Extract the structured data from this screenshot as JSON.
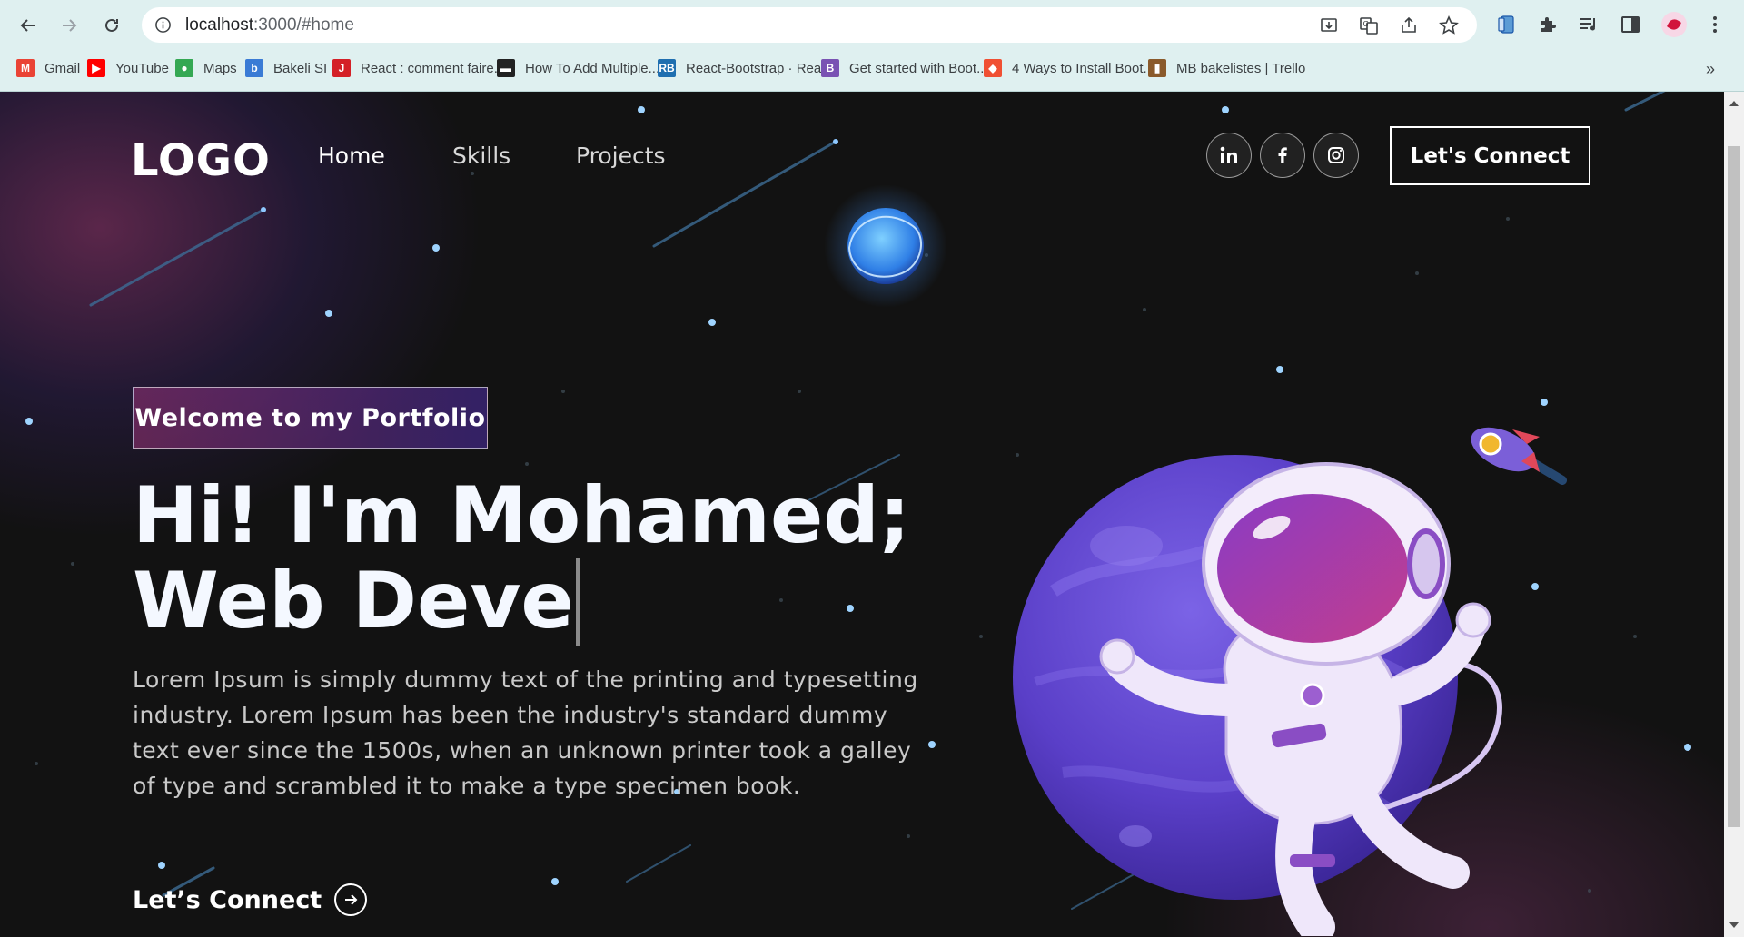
{
  "browser": {
    "url_host": "localhost",
    "url_path": ":3000/#home",
    "bookmarks": [
      {
        "label": "Gmail",
        "icon": "gmail-icon",
        "color": "#ea4335",
        "glyph": "M"
      },
      {
        "label": "YouTube",
        "icon": "youtube-icon",
        "color": "#ff0000",
        "glyph": "▶"
      },
      {
        "label": "Maps",
        "icon": "maps-icon",
        "color": "#34a853",
        "glyph": "●"
      },
      {
        "label": "Bakeli SI",
        "icon": "bakeli-icon",
        "color": "#3a7bd5",
        "glyph": "b"
      },
      {
        "label": "React : comment faire...",
        "icon": "j-icon",
        "color": "#d42027",
        "glyph": "J"
      },
      {
        "label": "How To Add Multiple...",
        "icon": "page-icon",
        "color": "#222222",
        "glyph": "▬"
      },
      {
        "label": "React-Bootstrap · Rea...",
        "icon": "react-bootstrap-icon",
        "color": "#1f6fb0",
        "glyph": "RB"
      },
      {
        "label": "Get started with Boot...",
        "icon": "bootstrap-icon",
        "color": "#7952b3",
        "glyph": "B"
      },
      {
        "label": "4 Ways to Install Boot...",
        "icon": "diamond-icon",
        "color": "#f05033",
        "glyph": "◆"
      },
      {
        "label": "MB bakelistes | Trello",
        "icon": "trello-icon",
        "color": "#8a5a2b",
        "glyph": "▮"
      }
    ],
    "bookmarks_overflow": "»"
  },
  "nav": {
    "logo": "LOGO",
    "links": [
      "Home",
      "Skills",
      "Projects"
    ],
    "social": [
      "linkedin-icon",
      "facebook-icon",
      "instagram-icon"
    ],
    "connect_label": "Let's Connect"
  },
  "hero": {
    "tagline": "Welcome to my Portfolio",
    "headline_line1": "Hi! I'm Mohamed;",
    "headline_line2": "Web Deve",
    "description": "Lorem Ipsum is simply dummy text of the printing and typesetting industry. Lorem Ipsum has been the industry's standard dummy text ever since the 1500s, when an unknown printer took a galley of type and scrambled it to make a type specimen book.",
    "connect_label": "Let’s Connect"
  },
  "colors": {
    "accent_pink": "#aa367c",
    "accent_purple": "#4a2fbd",
    "background": "#121212"
  }
}
